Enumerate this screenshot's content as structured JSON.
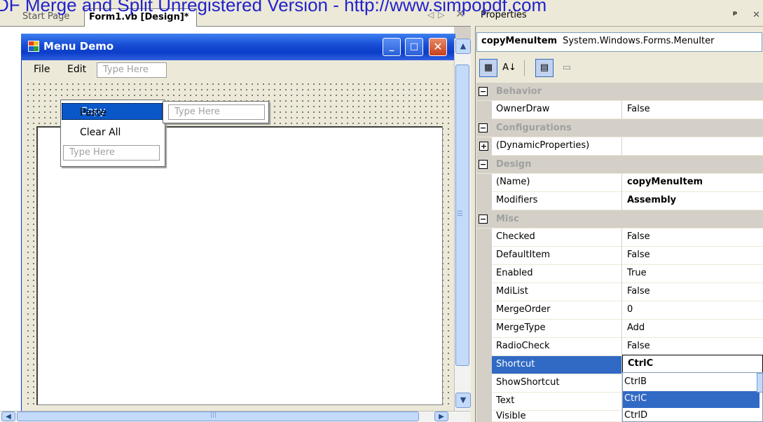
{
  "watermark": "DF Merge and Split Unregistered Version - http://www.simpopdf.com",
  "tabs": {
    "start_page": "Start Page",
    "form_design": "Form1.vb [Design]*"
  },
  "form": {
    "title": "Menu Demo",
    "menubar": [
      "File",
      "Edit"
    ],
    "type_here": "Type Here",
    "edit_menu": [
      "Copy",
      "Paste",
      "Clear All"
    ]
  },
  "properties": {
    "title": "Properties",
    "object_name": "copyMenuItem",
    "object_type": "System.Windows.Forms.MenuIter",
    "categories": {
      "behavior": "Behavior",
      "configurations": "Configurations",
      "design": "Design",
      "misc": "Misc"
    },
    "rows": {
      "ownerdraw": {
        "name": "OwnerDraw",
        "value": "False"
      },
      "dynamic": {
        "name": "(DynamicProperties)",
        "value": ""
      },
      "name": {
        "name": "(Name)",
        "value": "copyMenuItem"
      },
      "modifiers": {
        "name": "Modifiers",
        "value": "Assembly"
      },
      "checked": {
        "name": "Checked",
        "value": "False"
      },
      "defaultitem": {
        "name": "DefaultItem",
        "value": "False"
      },
      "enabled": {
        "name": "Enabled",
        "value": "True"
      },
      "mdilist": {
        "name": "MdiList",
        "value": "False"
      },
      "mergeorder": {
        "name": "MergeOrder",
        "value": "0"
      },
      "mergetype": {
        "name": "MergeType",
        "value": "Add"
      },
      "radiocheck": {
        "name": "RadioCheck",
        "value": "False"
      },
      "shortcut": {
        "name": "Shortcut",
        "value": "CtrlC"
      },
      "showshortcut": {
        "name": "ShowShortcut",
        "value": ""
      },
      "text": {
        "name": "Text",
        "value": ""
      },
      "visible": {
        "name": "Visible",
        "value": ""
      }
    },
    "shortcut_options": [
      "CtrlB",
      "CtrlC",
      "CtrlD"
    ]
  },
  "colors": {
    "selection": "#316ac5",
    "menu_highlight": "#0a58c8",
    "watermark": "#2222cc"
  }
}
